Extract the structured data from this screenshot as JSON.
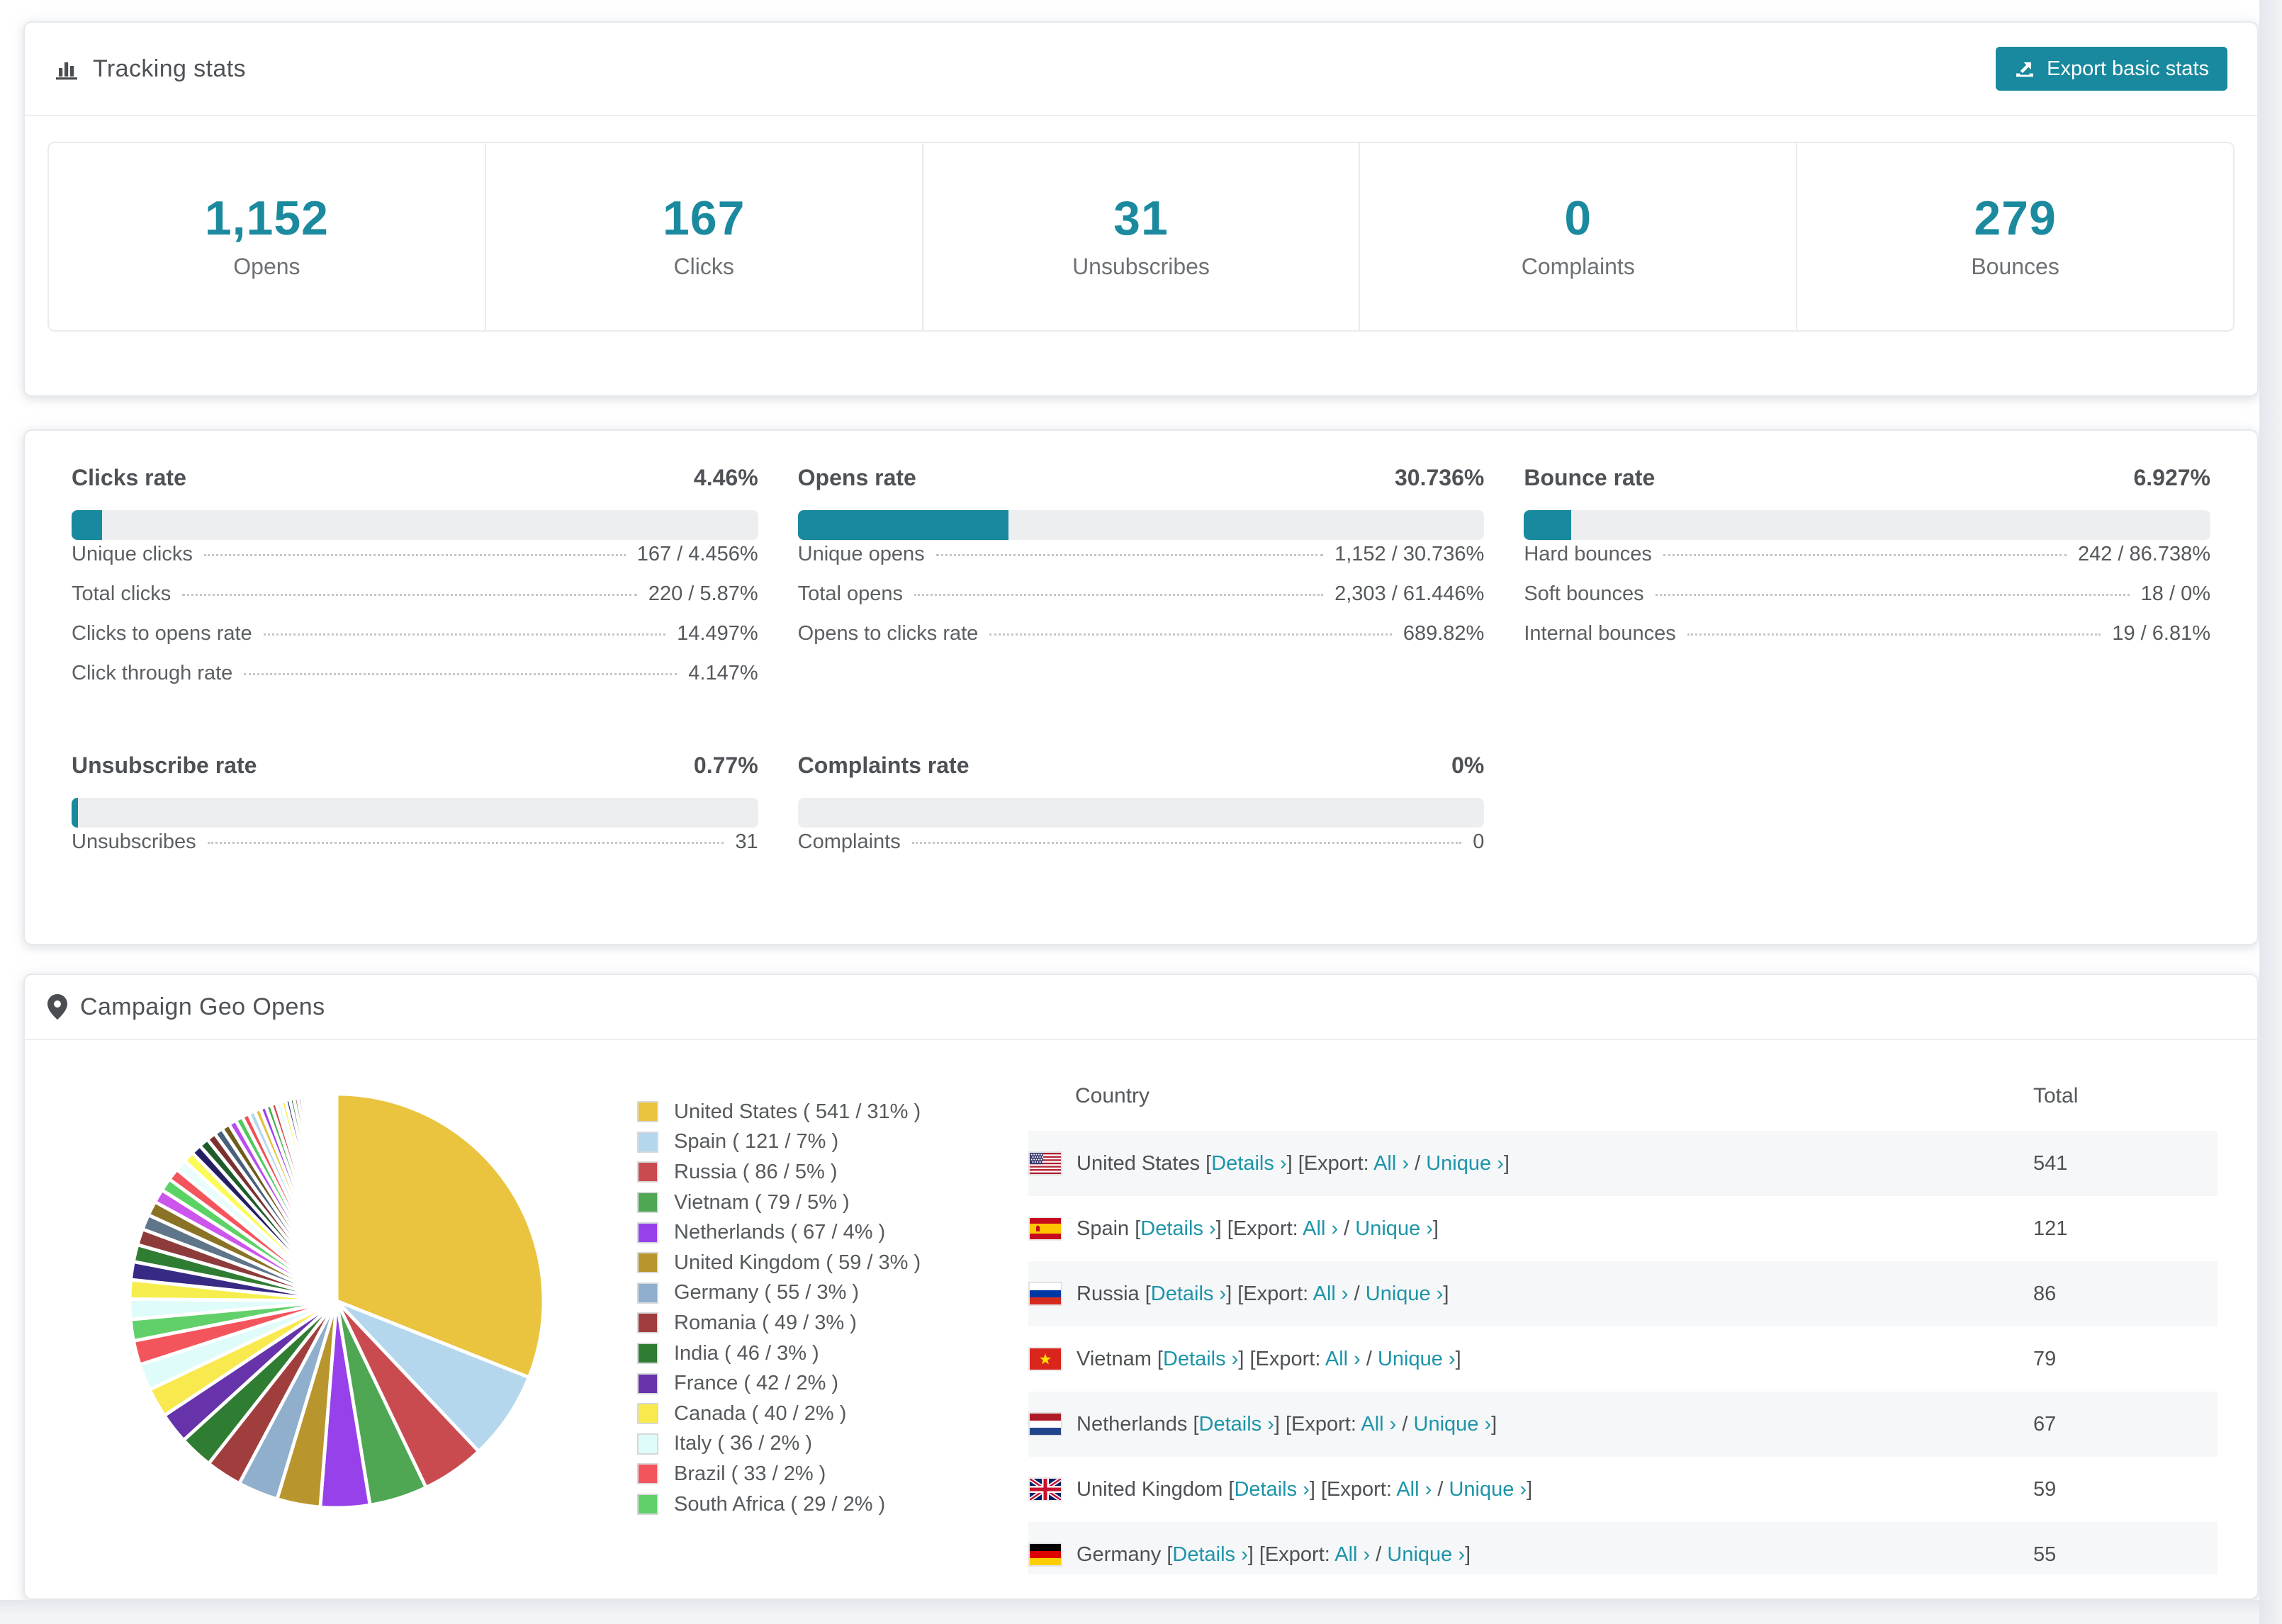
{
  "tracking": {
    "title": "Tracking stats",
    "export_button": "Export basic stats",
    "stats": [
      {
        "value": "1,152",
        "label": "Opens"
      },
      {
        "value": "167",
        "label": "Clicks"
      },
      {
        "value": "31",
        "label": "Unsubscribes"
      },
      {
        "value": "0",
        "label": "Complaints"
      },
      {
        "value": "279",
        "label": "Bounces"
      }
    ]
  },
  "rates": [
    {
      "title": "Clicks rate",
      "value": "4.46%",
      "percent": 4.46,
      "rows": [
        [
          "Unique clicks",
          "167 / 4.456%"
        ],
        [
          "Total clicks",
          "220 / 5.87%"
        ],
        [
          "Clicks to opens rate",
          "14.497%"
        ],
        [
          "Click through rate",
          "4.147%"
        ]
      ]
    },
    {
      "title": "Opens rate",
      "value": "30.736%",
      "percent": 30.736,
      "rows": [
        [
          "Unique opens",
          "1,152 / 30.736%"
        ],
        [
          "Total opens",
          "2,303 / 61.446%"
        ],
        [
          "Opens to clicks rate",
          "689.82%"
        ]
      ]
    },
    {
      "title": "Bounce rate",
      "value": "6.927%",
      "percent": 6.927,
      "rows": [
        [
          "Hard bounces",
          "242 / 86.738%"
        ],
        [
          "Soft bounces",
          "18 / 0%"
        ],
        [
          "Internal bounces",
          "19 / 6.81%"
        ]
      ]
    },
    {
      "title": "Unsubscribe rate",
      "value": "0.77%",
      "percent": 0.77,
      "rows": [
        [
          "Unsubscribes",
          "31"
        ]
      ]
    },
    {
      "title": "Complaints rate",
      "value": "0%",
      "percent": 0,
      "rows": [
        [
          "Complaints",
          "0"
        ]
      ]
    }
  ],
  "geo": {
    "title": "Campaign Geo Opens",
    "columns": {
      "country": "Country",
      "total": "Total"
    },
    "link_labels": {
      "details": "Details ›",
      "export_prefix": "Export:",
      "all": "All ›",
      "unique": "Unique ›"
    },
    "rows": [
      {
        "flag": "us",
        "country": "United States",
        "total": "541"
      },
      {
        "flag": "es",
        "country": "Spain",
        "total": "121"
      },
      {
        "flag": "ru",
        "country": "Russia",
        "total": "86"
      },
      {
        "flag": "vn",
        "country": "Vietnam",
        "total": "79"
      },
      {
        "flag": "nl",
        "country": "Netherlands",
        "total": "67"
      },
      {
        "flag": "gb",
        "country": "United Kingdom",
        "total": "59"
      },
      {
        "flag": "de",
        "country": "Germany",
        "total": "55",
        "partial": true
      }
    ]
  },
  "chart_data": {
    "type": "pie",
    "title": "Campaign Geo Opens",
    "legend_position": "right",
    "labels": [
      "United States",
      "Spain",
      "Russia",
      "Vietnam",
      "Netherlands",
      "United Kingdom",
      "Germany",
      "Romania",
      "India",
      "France",
      "Canada",
      "Italy",
      "Brazil",
      "South Africa"
    ],
    "values": [
      541,
      121,
      86,
      79,
      67,
      59,
      55,
      49,
      46,
      42,
      40,
      36,
      33,
      29
    ],
    "percent_labels": [
      "31%",
      "7%",
      "5%",
      "5%",
      "4%",
      "3%",
      "3%",
      "3%",
      "3%",
      "2%",
      "2%",
      "2%",
      "2%",
      "2%"
    ],
    "colors": [
      "#eac33f",
      "#b5d7ee",
      "#c94b50",
      "#4fa653",
      "#9741ea",
      "#b8962d",
      "#8fafcc",
      "#a03e3e",
      "#2f7d32",
      "#6633ab",
      "#f8e94e",
      "#dffcfb",
      "#f4555c",
      "#62d06a"
    ],
    "others_total_estimate": 461,
    "others_slice_count_estimate": 45,
    "start_angle_deg": -90,
    "direction": "clockwise"
  },
  "colors": {
    "accent": "#18899e",
    "stat_number": "#1b8a9e",
    "link": "#1d94a9"
  }
}
